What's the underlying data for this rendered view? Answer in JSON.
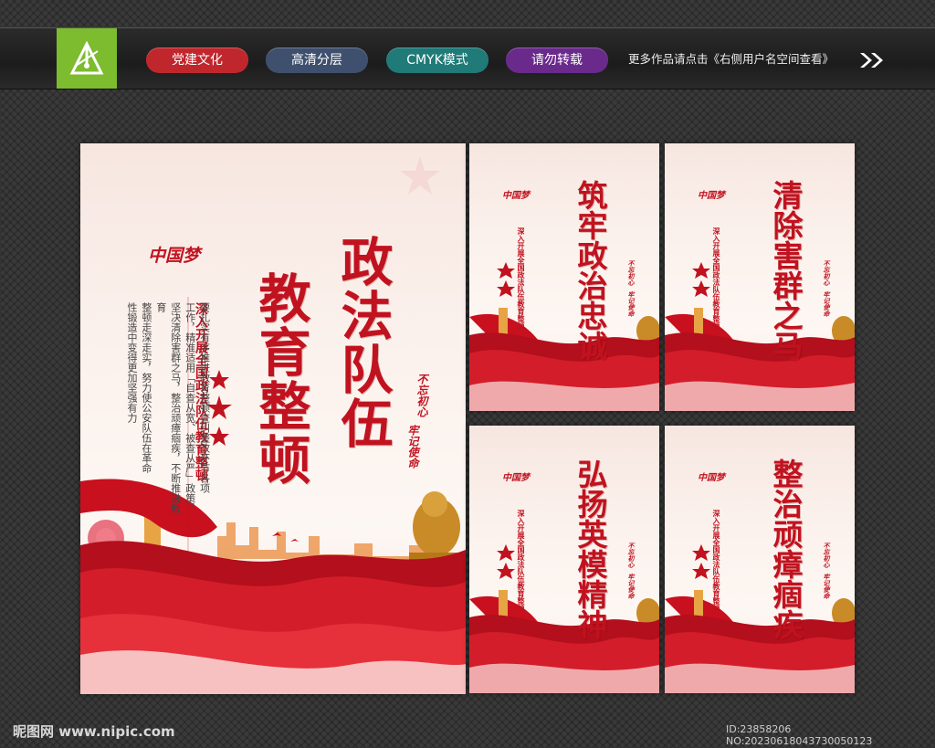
{
  "topbar": {
    "tags": [
      {
        "label": "党建文化",
        "color": "#c0272d"
      },
      {
        "label": "高清分层",
        "color": "#3f4f6e"
      },
      {
        "label": "CMYK模式",
        "color": "#1f7a78"
      },
      {
        "label": "请勿转载",
        "color": "#6a2a8c"
      }
    ],
    "promo": "更多作品请点击《右侧用户名空间查看》",
    "logo_icon": "pen-nib-icon",
    "arrow_icon": "double-chevron-right-icon"
  },
  "main_poster": {
    "brand": "中国梦",
    "title_col1": "政法队伍",
    "title_col2": "教育整顿",
    "subtitle": "深入开展全国政法队伍教育整顿",
    "body": [
      "要扎实有序推进教育整顿查纠整改环节各项",
      "工作，精准适用「自查从宽、被查从严」政策，",
      "坚决清除害群之马，整治顽瘴痼疾，不断推进教育",
      "整顿走深走实，努力使公安队伍在革命",
      "性锻造中变得更加坚强有力"
    ],
    "slogan_1": "不忘初心",
    "slogan_2": "牢记使命"
  },
  "small_posters": [
    {
      "brand": "中国梦",
      "title": "筑牢政治忠诚",
      "subtitle": "深入开展全国政法队伍教育整顿",
      "slogan_1": "不忘初心",
      "slogan_2": "牢记使命"
    },
    {
      "brand": "中国梦",
      "title": "清除害群之马",
      "subtitle": "深入开展全国政法队伍教育整顿",
      "slogan_1": "不忘初心",
      "slogan_2": "牢记使命"
    },
    {
      "brand": "中国梦",
      "title": "弘扬英模精神",
      "subtitle": "深入开展全国政法队伍教育整顿",
      "slogan_1": "不忘初心",
      "slogan_2": "牢记使命"
    },
    {
      "brand": "中国梦",
      "title": "整治顽瘴痼疾",
      "subtitle": "深入开展全国政法队伍教育整顿",
      "slogan_1": "不忘初心",
      "slogan_2": "牢记使命"
    }
  ],
  "footer": {
    "watermark": "昵图网 www.nipic.com",
    "id_line": "ID:23858206 NO:20230618043730050123"
  },
  "colors": {
    "party_red": "#c1121f",
    "poster_bg": "#fbf1ec"
  }
}
